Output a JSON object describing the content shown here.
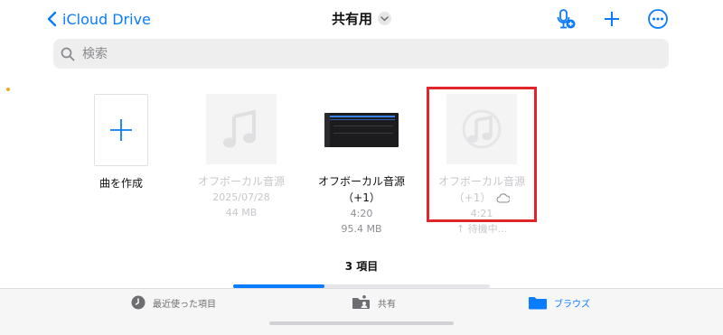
{
  "header": {
    "back_label": "iCloud Drive",
    "title": "共有用",
    "icons": [
      "chevron-left-icon",
      "mic-icon",
      "plus-icon",
      "more-icon"
    ]
  },
  "search": {
    "placeholder": "検索"
  },
  "items": [
    {
      "name": "曲を作成",
      "type": "create"
    },
    {
      "name": "オフボーカル音源",
      "date": "2025/07/28",
      "size": "44 MB",
      "state": "faded"
    },
    {
      "name_line1": "オフボーカル音源",
      "name_line2": "（+1）",
      "duration": "4:20",
      "size": "95.4 MB"
    },
    {
      "name_line1": "オフボーカル音源",
      "name_line2": "（+1）",
      "duration": "4:21",
      "status": "↑ 待機中...",
      "state": "faded"
    }
  ],
  "count_label": "3 項目",
  "tabs": [
    {
      "label": "最近使った項目",
      "icon": "clock-icon"
    },
    {
      "label": "共有",
      "icon": "shared-folder-icon"
    },
    {
      "label": "ブラウズ",
      "icon": "folder-icon",
      "active": true
    }
  ],
  "colors": {
    "accent": "#0a7cff",
    "highlight": "#e0252b"
  }
}
